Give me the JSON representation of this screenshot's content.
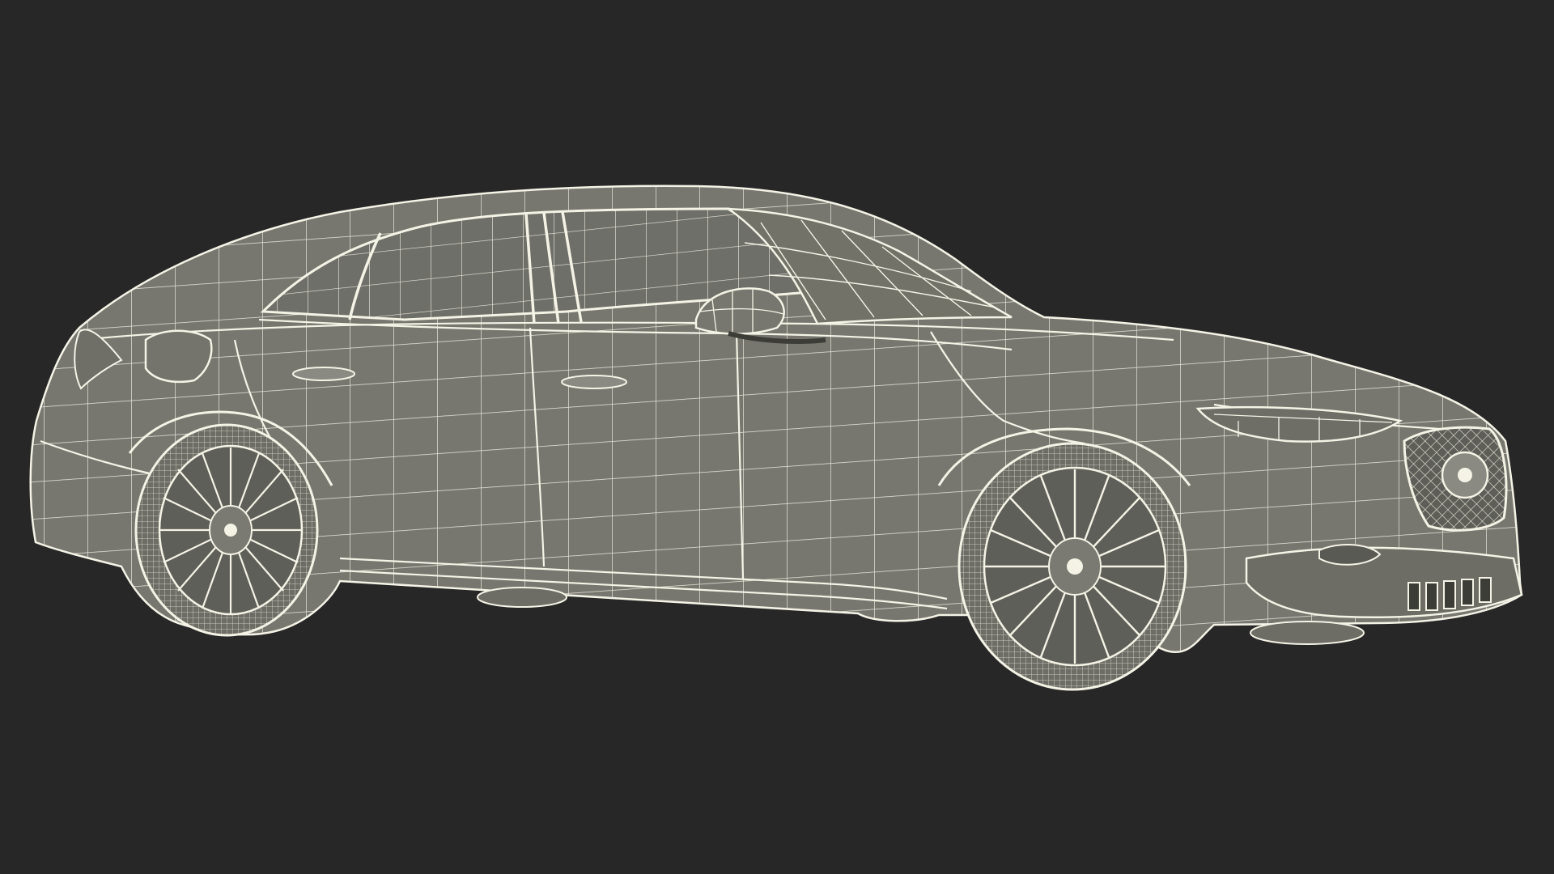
{
  "viewport": {
    "background_color": "#272727"
  },
  "model": {
    "subject": "sedan-car",
    "render_style": "wireframe",
    "surface_color": "#777770",
    "wire_color": "#f4f3e6",
    "dark_detail_color": "#3d3d38"
  }
}
